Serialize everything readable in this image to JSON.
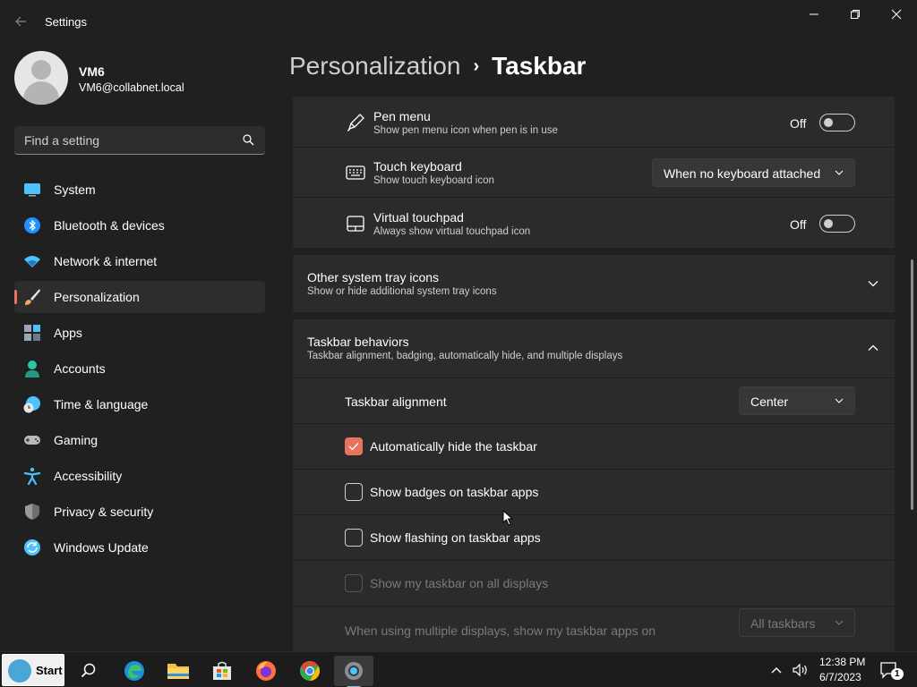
{
  "window": {
    "app_title": "Settings"
  },
  "profile": {
    "name": "VM6",
    "email": "VM6@collabnet.local"
  },
  "search": {
    "placeholder": "Find a setting"
  },
  "nav": {
    "items": [
      {
        "label": "System",
        "icon": "system-icon",
        "color": "#4cc2ff"
      },
      {
        "label": "Bluetooth & devices",
        "icon": "bluetooth-icon",
        "color": "#1e90ff"
      },
      {
        "label": "Network & internet",
        "icon": "wifi-icon",
        "color": "#4cc2ff"
      },
      {
        "label": "Personalization",
        "icon": "brush-icon",
        "color": "#e8a96b",
        "active": true
      },
      {
        "label": "Apps",
        "icon": "apps-icon",
        "color": "#9aa7b8"
      },
      {
        "label": "Accounts",
        "icon": "account-icon",
        "color": "#2ec4a6"
      },
      {
        "label": "Time & language",
        "icon": "clock-globe-icon",
        "color": "#4cc2ff"
      },
      {
        "label": "Gaming",
        "icon": "gamepad-icon",
        "color": "#b9b9b9"
      },
      {
        "label": "Accessibility",
        "icon": "accessibility-icon",
        "color": "#4cc2ff"
      },
      {
        "label": "Privacy & security",
        "icon": "shield-icon",
        "color": "#9a9a9a"
      },
      {
        "label": "Windows Update",
        "icon": "update-icon",
        "color": "#4cc2ff"
      }
    ]
  },
  "breadcrumb": {
    "parent": "Personalization",
    "separator": "›",
    "current": "Taskbar"
  },
  "tray_corner": {
    "pen_menu": {
      "title": "Pen menu",
      "subtitle": "Show pen menu icon when pen is in use",
      "state_label": "Off"
    },
    "touch_keyboard": {
      "title": "Touch keyboard",
      "subtitle": "Show touch keyboard icon",
      "selected": "When no keyboard attached"
    },
    "virtual_touchpad": {
      "title": "Virtual touchpad",
      "subtitle": "Always show virtual touchpad icon",
      "state_label": "Off"
    }
  },
  "other_tray": {
    "title": "Other system tray icons",
    "subtitle": "Show or hide additional system tray icons"
  },
  "behaviors": {
    "title": "Taskbar behaviors",
    "subtitle": "Taskbar alignment, badging, automatically hide, and multiple displays",
    "alignment_label": "Taskbar alignment",
    "alignment_value": "Center",
    "auto_hide": {
      "label": "Automatically hide the taskbar",
      "checked": true
    },
    "badges": {
      "label": "Show badges on taskbar apps",
      "checked": false
    },
    "flashing": {
      "label": "Show flashing on taskbar apps",
      "checked": false
    },
    "all_displays": {
      "label": "Show my taskbar on all displays",
      "checked": false,
      "disabled": true
    },
    "multi_display_label": "When using multiple displays, show my taskbar apps on",
    "multi_display_value": "All taskbars"
  },
  "taskbar": {
    "start_label": "Start",
    "apps": [
      "search-icon",
      "edge-icon",
      "file-explorer-icon",
      "store-icon",
      "firefox-icon",
      "chrome-icon",
      "settings-icon"
    ],
    "time": "12:38 PM",
    "date": "6/7/2023",
    "notification_count": "1"
  },
  "colors": {
    "accent": "#e8745e",
    "background": "#202020",
    "card": "#2b2b2b"
  }
}
